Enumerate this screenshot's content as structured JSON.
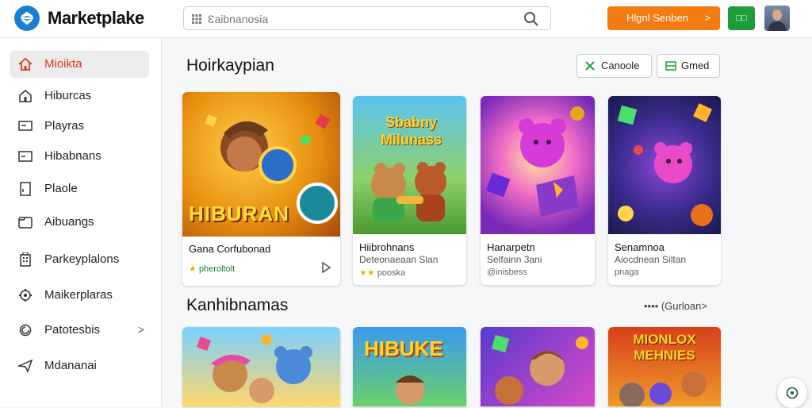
{
  "header": {
    "brand": "Marketplake",
    "search_placeholder": "Ɛaibnanosia",
    "primary_button": "Hlgnl Senben",
    "primary_chevron": ">",
    "secondary_button": "□□"
  },
  "sidebar": {
    "items": [
      {
        "label": "Mioikta",
        "icon": "home-icon",
        "active": true
      },
      {
        "label": "Hiburcas",
        "icon": "house-icon"
      },
      {
        "label": "Playras",
        "icon": "screen-icon"
      },
      {
        "label": "Hibabnans",
        "icon": "window-icon"
      },
      {
        "label": "Plaole",
        "icon": "page-icon"
      },
      {
        "label": "Aibuangs",
        "icon": "folder-icon"
      },
      {
        "label": "Parkeyplalons",
        "icon": "building-icon"
      },
      {
        "label": "Maikerplaras",
        "icon": "gear-icon"
      },
      {
        "label": "Patotesbis",
        "icon": "settings-icon",
        "arrow": ">"
      },
      {
        "label": "Mdananai",
        "icon": "send-icon"
      }
    ]
  },
  "main": {
    "section1_title": "Hoirkaypian",
    "chip_cancel": "Canoole",
    "chip_grid": "Gmed",
    "section2_title": "Kanhibnamas",
    "see_more": "•••• (Gurloan",
    "see_more_chevron": ">",
    "cards_row1": [
      {
        "title": "Gana Corfubonad",
        "sub": "",
        "meta": "pheroltolt",
        "thumb_text": "HIBURAN",
        "accent": "#e8900f"
      },
      {
        "title": "Hiibrohnans",
        "sub": "Deteonaeaan Slan",
        "meta": "pooska",
        "thumb_text": "Sbabny Milunass",
        "accent": "#3a9a2c"
      },
      {
        "title": "Hanarpetn",
        "sub": "Selfainn 3ani",
        "meta": "@inisbess",
        "thumb_text": "",
        "accent": "#d93ec8"
      },
      {
        "title": "Senamnoa",
        "sub": "Aiocdnean Siltan",
        "meta": "pnaga",
        "thumb_text": "",
        "accent": "#3a2a8c"
      }
    ],
    "cards_row2": [
      {
        "thumb_text": "",
        "accent": "#e06aa8"
      },
      {
        "thumb_text": "HIBUKE",
        "accent": "#2a7fd6"
      },
      {
        "thumb_text": "",
        "accent": "#5a3ad0"
      },
      {
        "thumb_text": "MIONLOX MEHNIES",
        "accent": "#d8401a"
      }
    ]
  }
}
